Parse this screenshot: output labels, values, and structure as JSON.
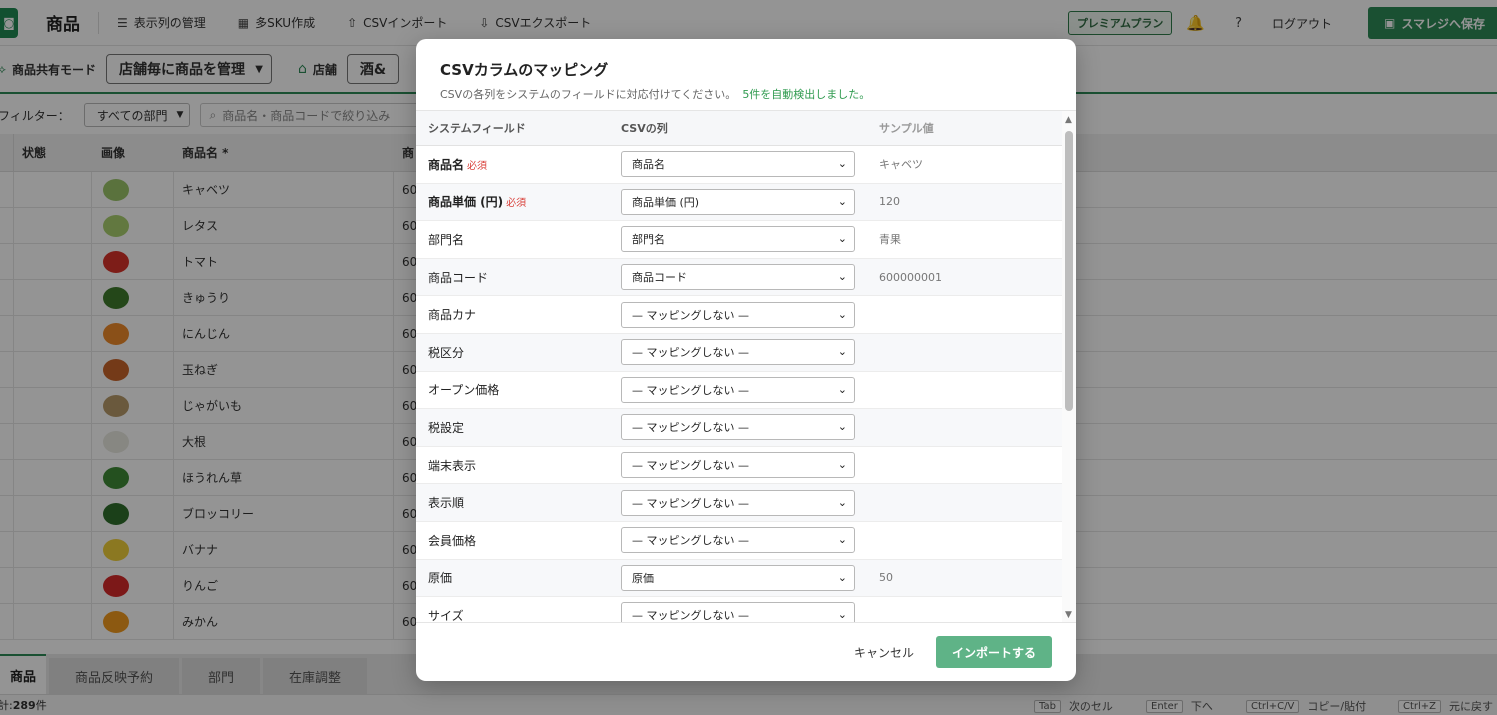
{
  "topbar": {
    "title": "商品",
    "tools": [
      "表示列の管理",
      "多SKU作成",
      "CSVインポート",
      "CSVエクスポート"
    ],
    "plan": "プレミアムプラン",
    "help": "?",
    "logout": "ログアウト",
    "save": "スマレジへ保存"
  },
  "modebar": {
    "mode_label": "商品共有モード",
    "mode_value": "店舗毎に商品を管理",
    "store_label": "店舗",
    "store_value": "酒&"
  },
  "filterbar": {
    "label": "フィルター：",
    "dept": "すべての部門",
    "search_placeholder": "商品名・商品コードで絞り込み"
  },
  "grid": {
    "headers": [
      "状態",
      "画像",
      "商品名 *",
      "商"
    ],
    "rows": [
      {
        "name": "キャベツ",
        "code": "60",
        "color": "#9bc46a"
      },
      {
        "name": "レタス",
        "code": "60",
        "color": "#a9cf6e"
      },
      {
        "name": "トマト",
        "code": "60",
        "color": "#d8332a"
      },
      {
        "name": "きゅうり",
        "code": "60",
        "color": "#3f7a2c"
      },
      {
        "name": "にんじん",
        "code": "60",
        "color": "#ee8a2a"
      },
      {
        "name": "玉ねぎ",
        "code": "60",
        "color": "#c9652a"
      },
      {
        "name": "じゃがいも",
        "code": "60",
        "color": "#b79a6a"
      },
      {
        "name": "大根",
        "code": "60",
        "color": "#e8e8e0"
      },
      {
        "name": "ほうれん草",
        "code": "60",
        "color": "#3e8b36"
      },
      {
        "name": "ブロッコリー",
        "code": "60",
        "color": "#2f6e2c"
      },
      {
        "name": "バナナ",
        "code": "60",
        "color": "#f0cf3a"
      },
      {
        "name": "りんご",
        "code": "60",
        "color": "#d62a2a"
      },
      {
        "name": "みかん",
        "code": "60",
        "color": "#f29a1e"
      }
    ]
  },
  "bottom_tabs": [
    "商品",
    "商品反映予約",
    "部門",
    "在庫調整"
  ],
  "status": {
    "total_label": "計:",
    "total_value": "289",
    "total_unit": "件",
    "shortcuts": [
      {
        "key": "Tab",
        "label": "次のセル"
      },
      {
        "key": "Enter",
        "label": "下へ"
      },
      {
        "key": "Ctrl+C/V",
        "label": "コピー/貼付"
      },
      {
        "key": "Ctrl+Z",
        "label": "元に戻す"
      }
    ]
  },
  "modal": {
    "title": "CSVカラムのマッピング",
    "subtitle": "CSVの各列をシステムのフィールドに対応付けてください。",
    "detected": "5件を自動検出しました。",
    "headers": {
      "field": "システムフィールド",
      "csv": "CSVの列",
      "sample": "サンプル値"
    },
    "required_mark": "必須",
    "rows": [
      {
        "field": "商品名",
        "required": true,
        "csv": "商品名",
        "sample": "キャベツ"
      },
      {
        "field": "商品単価 (円)",
        "required": true,
        "csv": "商品単価 (円)",
        "sample": "120"
      },
      {
        "field": "部門名",
        "required": false,
        "csv": "部門名",
        "sample": "青果"
      },
      {
        "field": "商品コード",
        "required": false,
        "csv": "商品コード",
        "sample": "600000001"
      },
      {
        "field": "商品カナ",
        "required": false,
        "csv": "— マッピングしない —",
        "sample": ""
      },
      {
        "field": "税区分",
        "required": false,
        "csv": "— マッピングしない —",
        "sample": ""
      },
      {
        "field": "オープン価格",
        "required": false,
        "csv": "— マッピングしない —",
        "sample": ""
      },
      {
        "field": "税設定",
        "required": false,
        "csv": "— マッピングしない —",
        "sample": ""
      },
      {
        "field": "端末表示",
        "required": false,
        "csv": "— マッピングしない —",
        "sample": ""
      },
      {
        "field": "表示順",
        "required": false,
        "csv": "— マッピングしない —",
        "sample": ""
      },
      {
        "field": "会員価格",
        "required": false,
        "csv": "— マッピングしない —",
        "sample": ""
      },
      {
        "field": "原価",
        "required": false,
        "csv": "原価",
        "sample": "50"
      },
      {
        "field": "サイズ",
        "required": false,
        "csv": "— マッピングしない —",
        "sample": ""
      }
    ],
    "cancel": "キャンセル",
    "import": "インポートする"
  }
}
